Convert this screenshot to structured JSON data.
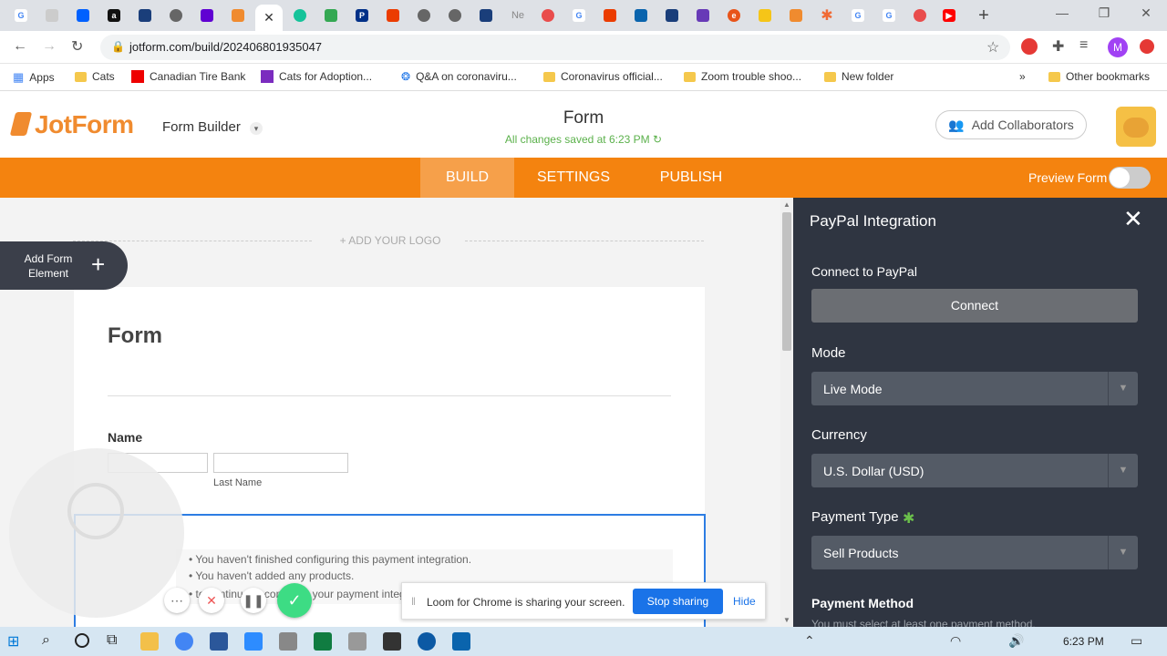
{
  "browser": {
    "url": "jotform.com/build/202406801935047",
    "bookmarks": [
      {
        "label": "Apps"
      },
      {
        "label": "Cats"
      },
      {
        "label": "Canadian Tire Bank"
      },
      {
        "label": "Cats for Adoption..."
      },
      {
        "label": "Q&A on coronaviru..."
      },
      {
        "label": "Coronavirus official..."
      },
      {
        "label": "Zoom trouble shoo..."
      },
      {
        "label": "New folder"
      },
      {
        "label": "Other bookmarks"
      }
    ],
    "more_bookmarks": "»",
    "new_tab_tab_label": "Ne",
    "profile_initial": "M"
  },
  "header": {
    "logo": "JotForm",
    "builder_label": "Form Builder",
    "form_title": "Form",
    "saved_status": "All changes saved at 6:23 PM",
    "collab_label": "Add Collaborators"
  },
  "nav": {
    "tabs": [
      "BUILD",
      "SETTINGS",
      "PUBLISH"
    ],
    "active_tab": "BUILD",
    "preview_label": "Preview Form",
    "accent": "#f4830f"
  },
  "canvas": {
    "add_logo": "+ ADD YOUR LOGO",
    "add_element_label": "Add Form Element",
    "form_heading": "Form",
    "name_label": "Name",
    "last_name_sublabel": "Last Name",
    "warnings": [
      "You haven't finished configuring this payment integration.",
      "You haven't added any products.",
      "to continue to configure your payment integration."
    ]
  },
  "panel": {
    "title": "PayPal Integration",
    "connect_label": "Connect to PayPal",
    "connect_button": "Connect",
    "mode_label": "Mode",
    "mode_value": "Live Mode",
    "currency_label": "Currency",
    "currency_value": "U.S. Dollar (USD)",
    "payment_type_label": "Payment Type",
    "payment_type_value": "Sell Products",
    "payment_method_label": "Payment Method",
    "payment_method_note": "You must select at least one payment method.",
    "bg": "#2f3541"
  },
  "loom": {
    "sharing_text": "Loom for Chrome is sharing your screen.",
    "stop_label": "Stop sharing",
    "hide_label": "Hide"
  },
  "taskbar": {
    "time": "6:23 PM"
  }
}
